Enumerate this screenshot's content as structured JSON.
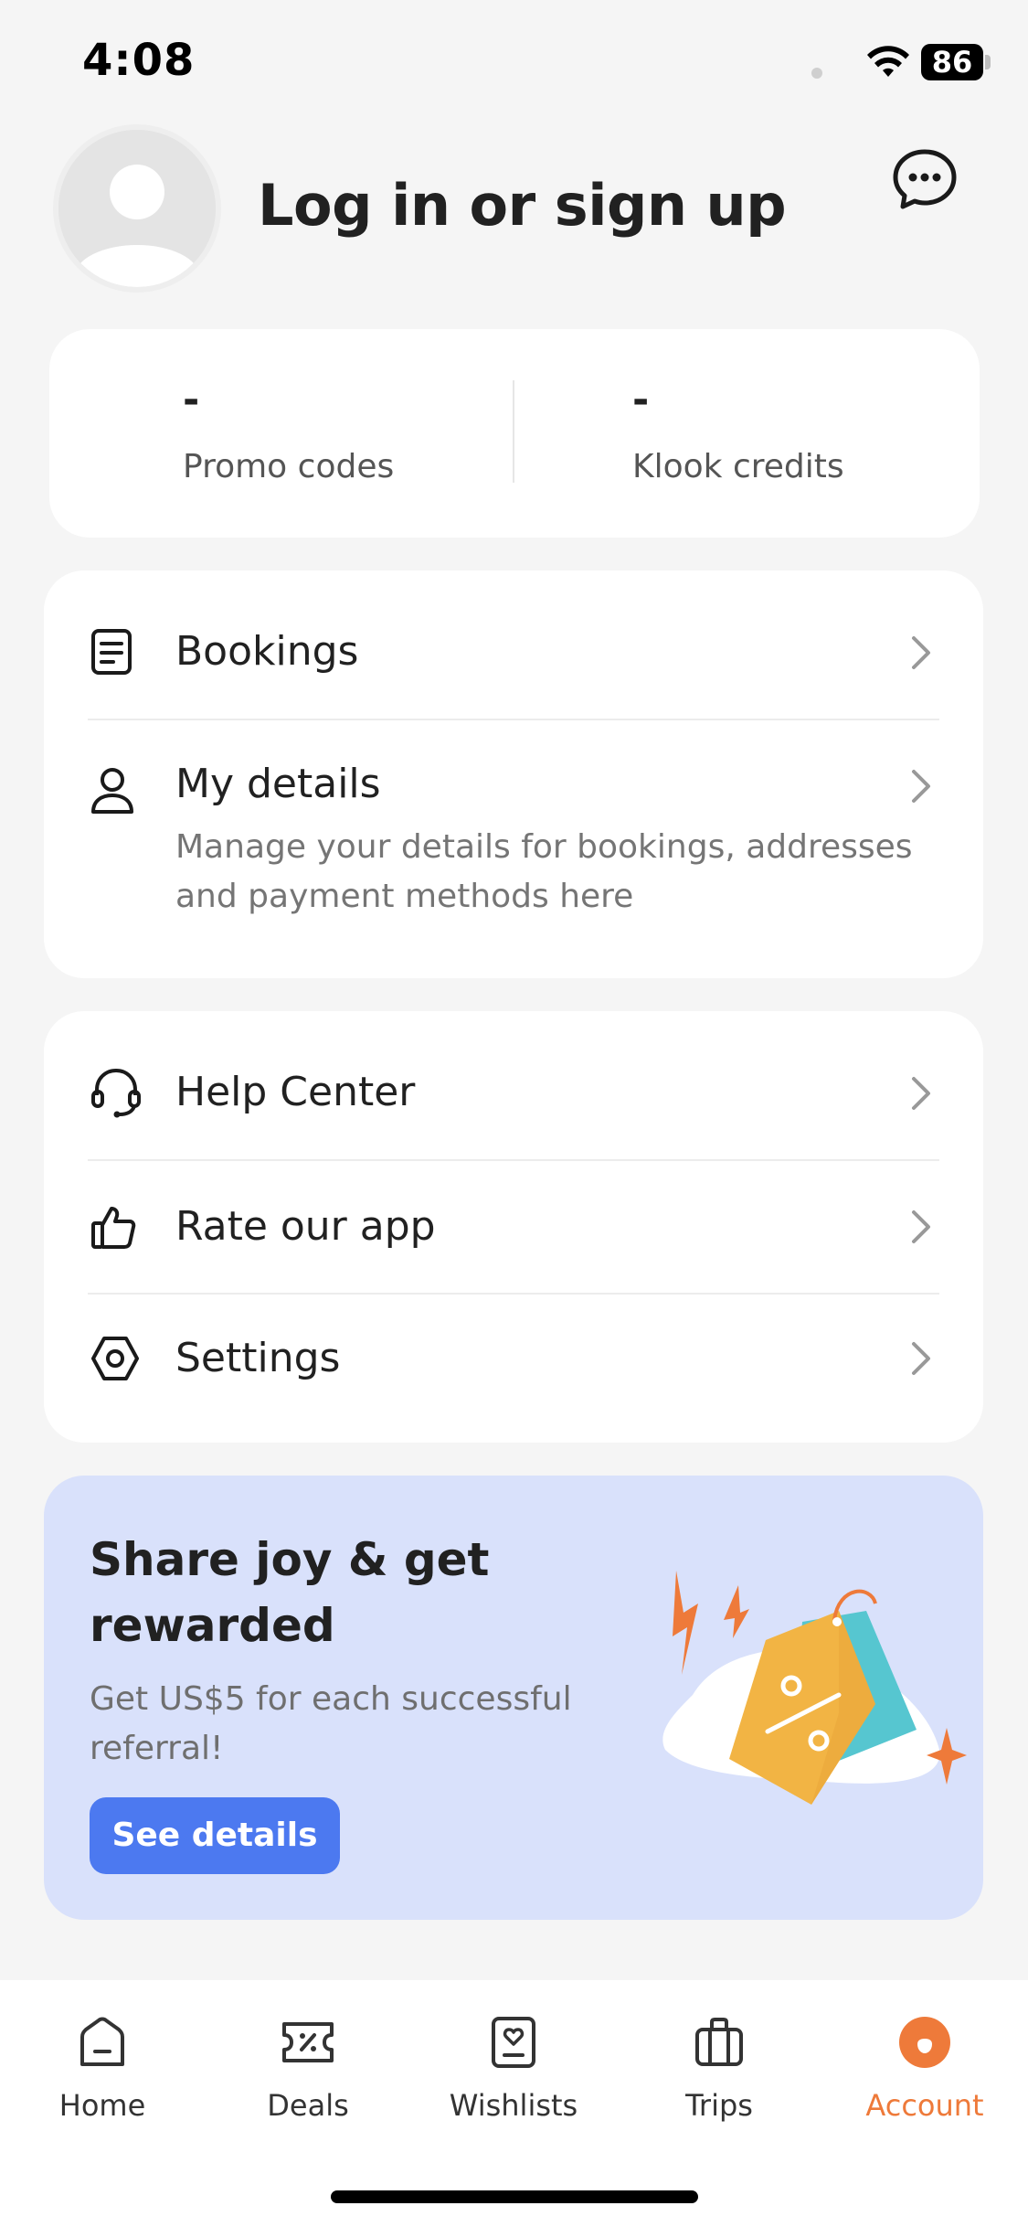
{
  "status_bar": {
    "time": "4:08",
    "battery": "86"
  },
  "header": {
    "title": "Log in or sign up"
  },
  "credits": {
    "promo_codes": {
      "value": "-",
      "label": "Promo codes"
    },
    "klook_credits": {
      "value": "-",
      "label": "Klook credits"
    }
  },
  "menu_account": [
    {
      "icon": "document-icon",
      "label": "Bookings"
    },
    {
      "icon": "person-icon",
      "label": "My details",
      "description": "Manage your details for bookings, addresses and payment methods here"
    }
  ],
  "menu_support": [
    {
      "icon": "headset-icon",
      "label": "Help Center"
    },
    {
      "icon": "thumbs-up-icon",
      "label": "Rate our app"
    },
    {
      "icon": "settings-hexagon-icon",
      "label": "Settings"
    }
  ],
  "promo": {
    "title": "Share joy & get rewarded",
    "description": "Get US$5 for each successful referral!",
    "button": "See details"
  },
  "tab_bar": {
    "active": "Account",
    "tabs": [
      {
        "icon": "home-icon",
        "label": "Home"
      },
      {
        "icon": "deals-icon",
        "label": "Deals"
      },
      {
        "icon": "wishlist-icon",
        "label": "Wishlists"
      },
      {
        "icon": "suitcase-icon",
        "label": "Trips"
      },
      {
        "icon": "account-icon",
        "label": "Account"
      }
    ]
  },
  "colors": {
    "accent": "#ee7a3a",
    "primary_button": "#4c79f0",
    "promo_background": "#d9e1fb",
    "page_background": "#f5f5f5"
  }
}
